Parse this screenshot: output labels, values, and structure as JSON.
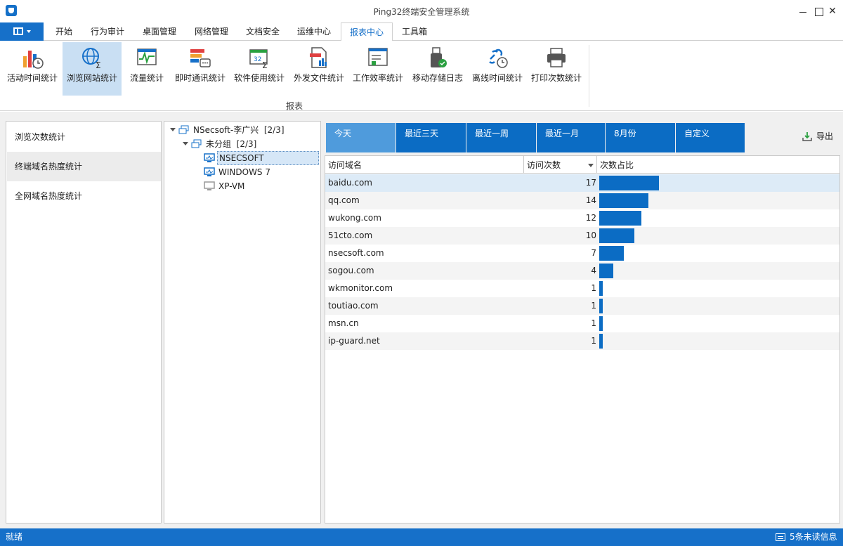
{
  "window": {
    "title": "Ping32终端安全管理系统"
  },
  "menu": {
    "tabs": [
      "开始",
      "行为审计",
      "桌面管理",
      "网络管理",
      "文档安全",
      "运维中心",
      "报表中心",
      "工具箱"
    ],
    "active_tab": "报表中心"
  },
  "ribbon": {
    "group_label": "报表",
    "buttons": [
      "活动时间统计",
      "浏览网站统计",
      "流量统计",
      "即时通讯统计",
      "软件使用统计",
      "外发文件统计",
      "工作效率统计",
      "移动存储日志",
      "离线时间统计",
      "打印次数统计"
    ],
    "active_button": "浏览网站统计"
  },
  "left_nav": {
    "items": [
      "浏览次数统计",
      "终端域名热度统计",
      "全网域名热度统计"
    ],
    "selected": "终端域名热度统计"
  },
  "tree": {
    "root": {
      "label": "NSecsoft-李广兴",
      "count": "[2/3]"
    },
    "group": {
      "label": "未分组",
      "count": "[2/3]"
    },
    "computers": [
      "NSECSOFT",
      "WINDOWS 7",
      "XP-VM"
    ],
    "selected": "NSECSOFT"
  },
  "date_tabs": {
    "items": [
      "今天",
      "最近三天",
      "最近一周",
      "最近一月",
      "8月份",
      "自定义"
    ],
    "active": "今天"
  },
  "export": {
    "label": "导出"
  },
  "table": {
    "columns": [
      "访问域名",
      "访问次数",
      "次数占比"
    ],
    "rows": [
      {
        "domain": "baidu.com",
        "count": 17
      },
      {
        "domain": "qq.com",
        "count": 14
      },
      {
        "domain": "wukong.com",
        "count": 12
      },
      {
        "domain": "51cto.com",
        "count": 10
      },
      {
        "domain": "nsecsoft.com",
        "count": 7
      },
      {
        "domain": "sogou.com",
        "count": 4
      },
      {
        "domain": "wkmonitor.com",
        "count": 1
      },
      {
        "domain": "toutiao.com",
        "count": 1
      },
      {
        "domain": "msn.cn",
        "count": 1
      },
      {
        "domain": "ip-guard.net",
        "count": 1
      }
    ]
  },
  "status": {
    "left": "就绪",
    "right": "5条未读信息"
  },
  "colors": {
    "accent": "#1670c9",
    "bar": "#0b6cc4",
    "tab_active": "#4f9bdc"
  }
}
